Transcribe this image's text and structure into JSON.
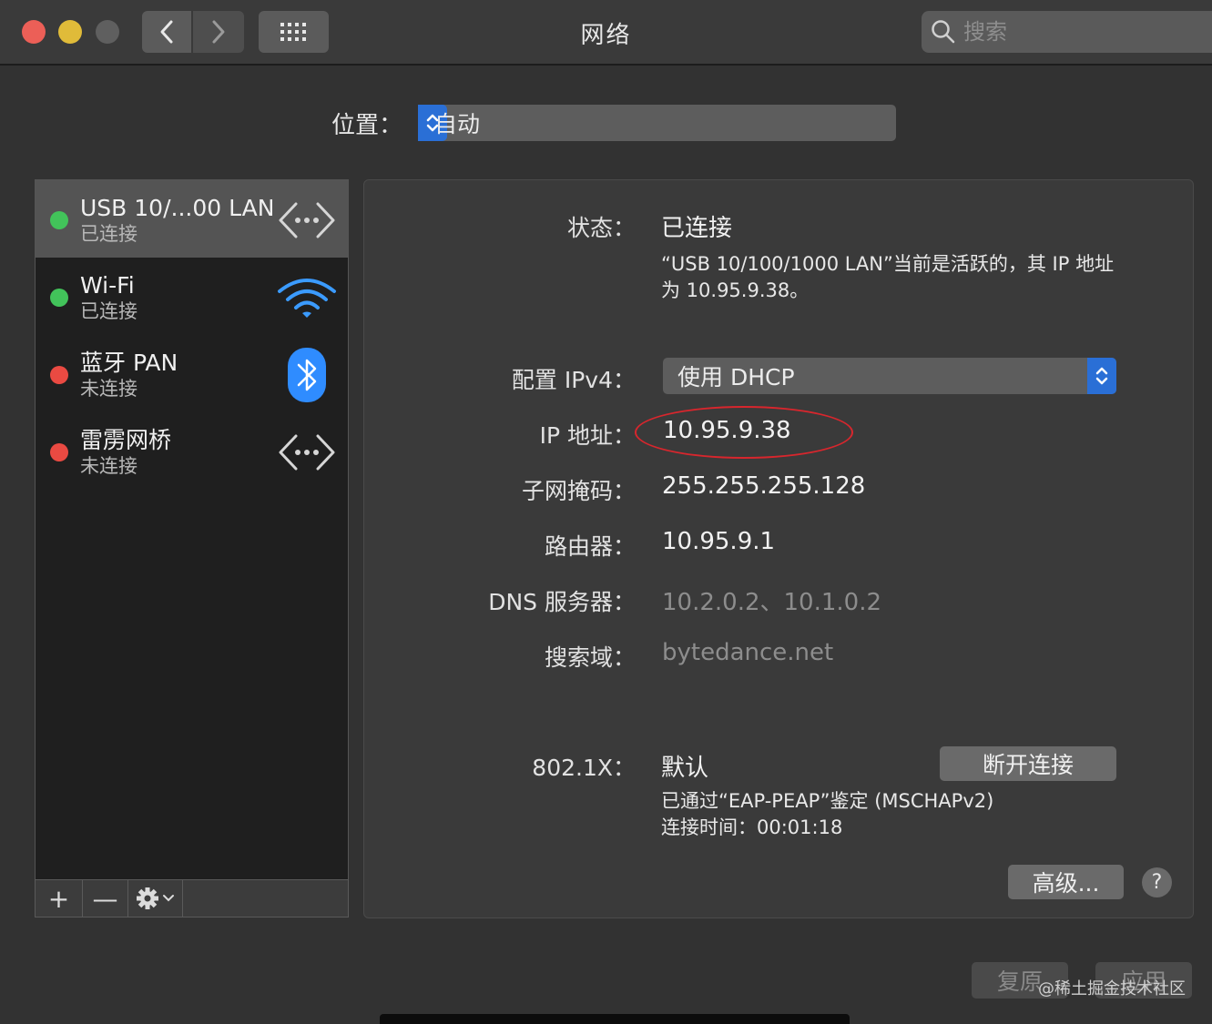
{
  "window": {
    "title": "网络",
    "search_placeholder": "搜索"
  },
  "location": {
    "label": "位置：",
    "value": "自动"
  },
  "services": [
    {
      "name": "USB 10/...00 LAN",
      "status": "已连接",
      "state": "green",
      "icon": "ethernet-icon",
      "selected": true
    },
    {
      "name": "Wi-Fi",
      "status": "已连接",
      "state": "green",
      "icon": "wifi-icon",
      "selected": false
    },
    {
      "name": "蓝牙 PAN",
      "status": "未连接",
      "state": "red",
      "icon": "bluetooth-icon",
      "selected": false
    },
    {
      "name": "雷雳网桥",
      "status": "未连接",
      "state": "red",
      "icon": "ethernet-icon",
      "selected": false
    }
  ],
  "toolbar": {
    "add": "+",
    "remove": "—"
  },
  "detail": {
    "status_label": "状态：",
    "status_value": "已连接",
    "status_desc": "“USB 10/100/1000 LAN”当前是活跃的，其 IP 地址为 10.95.9.38。",
    "ipv4_label": "配置 IPv4：",
    "ipv4_value": "使用 DHCP",
    "ip_label": "IP 地址：",
    "ip_value": "10.95.9.38",
    "subnet_label": "子网掩码：",
    "subnet_value": "255.255.255.128",
    "router_label": "路由器：",
    "router_value": "10.95.9.1",
    "dns_label": "DNS 服务器：",
    "dns_value": "10.2.0.2、10.1.0.2",
    "search_domain_label": "搜索域：",
    "search_domain_value": "bytedance.net",
    "dot1x_label": "802.1X：",
    "dot1x_value": "默认",
    "disconnect_button": "断开连接",
    "auth_desc": "已通过“EAP-PEAP”鉴定 (MSCHAPv2)",
    "connect_time": "连接时间：00:01:18",
    "advanced_button": "高级...",
    "help_button": "?"
  },
  "footer": {
    "revert_button": "复原",
    "apply_button": "应用",
    "watermark": "@稀土掘金技术社区"
  },
  "colors": {
    "accent": "#2a6fd6",
    "connected": "#42c35a",
    "disconnected": "#ea4a42",
    "highlight_ellipse": "#d8262d"
  }
}
